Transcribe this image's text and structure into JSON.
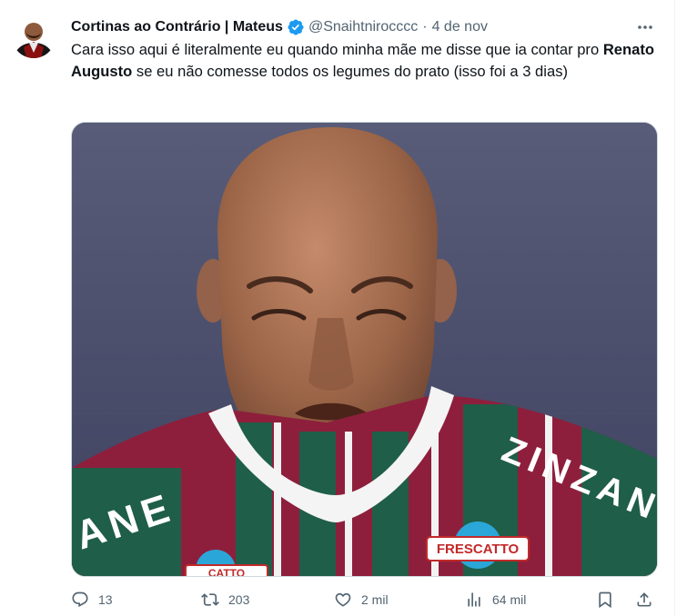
{
  "tweet": {
    "author": {
      "display_name": "Cortinas ao Contrário | Mateus",
      "handle": "@Snaihtnirocccc",
      "verified": true
    },
    "separator": "·",
    "date": "4 de nov",
    "text": {
      "part1": "Cara isso aqui é literalmente eu quando minha mãe me disse que ia contar pro ",
      "mention": "Renato Augusto",
      "part2": " se eu não comesse todos os legumes do prato (isso foi a 3 dias)"
    },
    "media": {
      "jersey_text_left": "ANE",
      "jersey_text_right": "ZINZAN",
      "sponsor": "FRESCATTO",
      "sponsor_partial": "CATTO"
    },
    "actions": {
      "reply_count": "13",
      "retweet_count": "203",
      "like_count": "2 mil",
      "views_count": "64 mil"
    }
  },
  "colors": {
    "text_primary": "#0f1419",
    "text_secondary": "#536471",
    "verified_blue": "#1d9bf0",
    "border": "#cfd9de"
  },
  "icons": [
    "avatar",
    "verified-badge-icon",
    "more-icon",
    "reply-icon",
    "retweet-icon",
    "like-icon",
    "views-icon",
    "bookmark-icon",
    "share-icon"
  ]
}
